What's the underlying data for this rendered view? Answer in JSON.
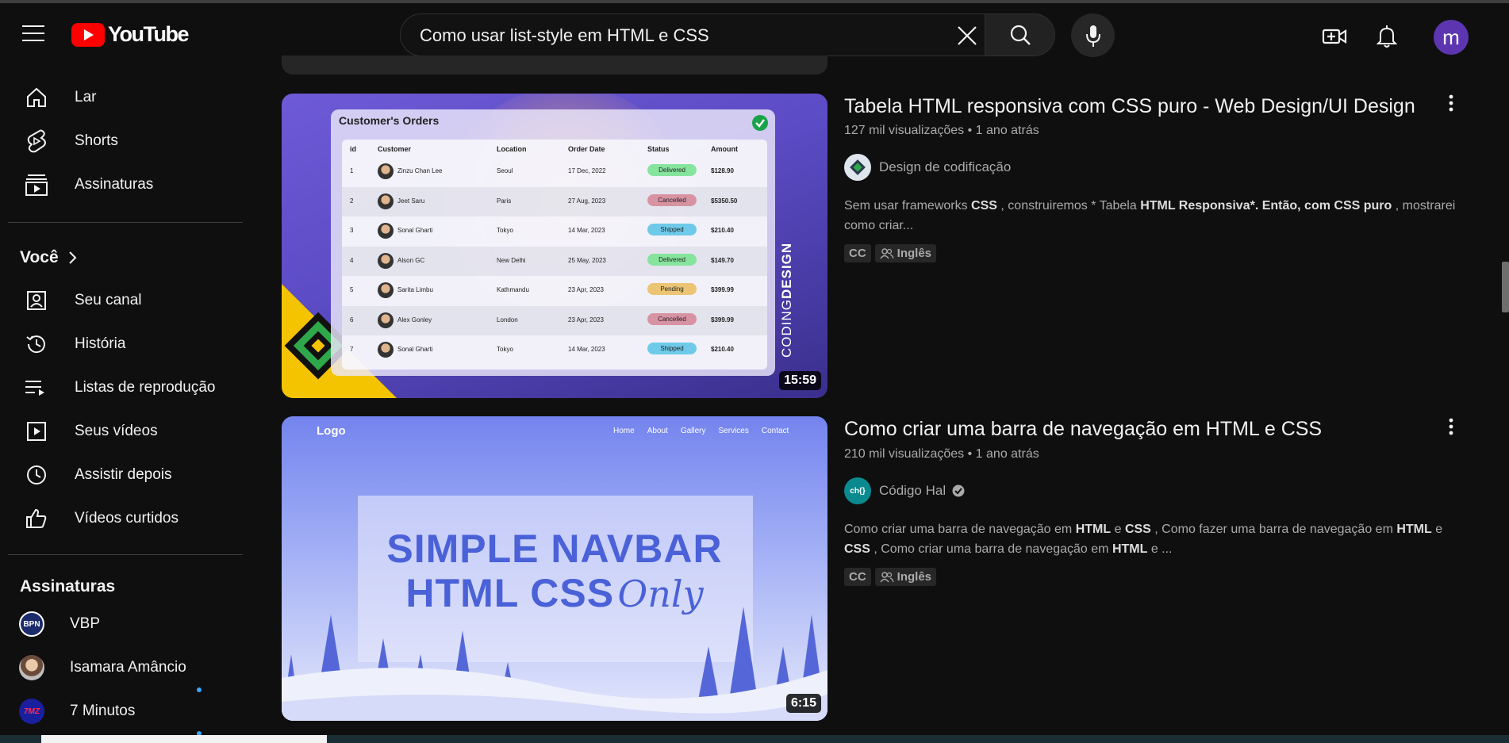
{
  "header": {
    "logo_text": "YouTube",
    "search_value": "Como usar list-style em HTML e CSS",
    "avatar_letter": "m",
    "icons": [
      "menu-icon",
      "youtube-logo-icon",
      "close-icon",
      "search-icon",
      "mic-icon",
      "create-video-icon",
      "bell-icon"
    ]
  },
  "sidebar": {
    "main": [
      {
        "label": "Lar",
        "icon": "home-icon"
      },
      {
        "label": "Shorts",
        "icon": "shorts-icon"
      },
      {
        "label": "Assinaturas",
        "icon": "subscriptions-icon"
      }
    ],
    "you_title": "Você",
    "you": [
      {
        "label": "Seu canal",
        "icon": "channel-icon"
      },
      {
        "label": "História",
        "icon": "history-icon"
      },
      {
        "label": "Listas de reprodução",
        "icon": "playlist-icon"
      },
      {
        "label": "Seus vídeos",
        "icon": "your-videos-icon"
      },
      {
        "label": "Assistir depois",
        "icon": "watch-later-icon"
      },
      {
        "label": "Vídeos curtidos",
        "icon": "like-icon"
      }
    ],
    "subs_title": "Assinaturas",
    "subs": [
      {
        "label": "VBP",
        "avatar": "BPN",
        "new": true
      },
      {
        "label": "Isamara Amâncio",
        "new": true
      },
      {
        "label": "7 Minutos",
        "avatar": "7MZ",
        "new": false
      }
    ]
  },
  "results": [
    {
      "title": "Tabela HTML responsiva com CSS puro - Web Design/UI Design",
      "meta": "127 mil visualizações • 1 ano atrás",
      "channel": "Design de codificação",
      "verified": false,
      "desc_parts": [
        {
          "t": "Sem usar frameworks ",
          "b": false
        },
        {
          "t": "CSS",
          "b": true
        },
        {
          "t": " , construiremos * Tabela ",
          "b": false
        },
        {
          "t": "HTML Responsiva*. Então, com CSS puro",
          "b": true
        },
        {
          "t": " , mostrarei como criar...",
          "b": false
        }
      ],
      "badges": [
        "CC",
        "Inglês"
      ],
      "duration": "15:59",
      "thumbnail": {
        "card_title": "Customer's Orders",
        "brand_text_a": "CODING",
        "brand_text_b": "DESIGN",
        "columns": [
          "id",
          "Customer",
          "Location",
          "Order Date",
          "Status",
          "Amount"
        ],
        "rows": [
          [
            "1",
            "Zinzu Chan Lee",
            "Seoul",
            "17 Dec, 2022",
            "Delivered",
            "$128.90"
          ],
          [
            "2",
            "Jeet Saru",
            "Paris",
            "27 Aug, 2023",
            "Cancelled",
            "$5350.50"
          ],
          [
            "3",
            "Sonal Gharti",
            "Tokyo",
            "14 Mar, 2023",
            "Shipped",
            "$210.40"
          ],
          [
            "4",
            "Alson GC",
            "New Delhi",
            "25 May, 2023",
            "Delivered",
            "$149.70"
          ],
          [
            "5",
            "Sarita Limbu",
            "Kathmandu",
            "23 Apr, 2023",
            "Pending",
            "$399.99"
          ],
          [
            "6",
            "Alex Gonley",
            "London",
            "23 Apr, 2023",
            "Cancelled",
            "$399.99"
          ],
          [
            "7",
            "Sonal Gharti",
            "Tokyo",
            "14 Mar, 2023",
            "Shipped",
            "$210.40"
          ]
        ],
        "status_colors": {
          "Delivered": "#86e49d",
          "Cancelled": "#d893a3",
          "Shipped": "#6fcaea",
          "Pending": "#ebc474"
        }
      }
    },
    {
      "title": "Como criar uma barra de navegação em HTML e CSS",
      "meta": "210 mil visualizações • 1 ano atrás",
      "channel": "Código Hal",
      "verified": true,
      "desc_parts": [
        {
          "t": "Como criar uma barra de navegação em ",
          "b": false
        },
        {
          "t": "HTML",
          "b": true
        },
        {
          "t": " e ",
          "b": false
        },
        {
          "t": "CSS",
          "b": true
        },
        {
          "t": " , Como fazer uma barra de navegação em ",
          "b": false
        },
        {
          "t": "HTML",
          "b": true
        },
        {
          "t": " e ",
          "b": false
        },
        {
          "t": "CSS",
          "b": true
        },
        {
          "t": " , Como criar uma barra de navegação em ",
          "b": false
        },
        {
          "t": "HTML",
          "b": true
        },
        {
          "t": " e ...",
          "b": false
        }
      ],
      "badges": [
        "CC",
        "Inglês"
      ],
      "duration": "6:15",
      "thumbnail": {
        "logo": "Logo",
        "nav": [
          "Home",
          "About",
          "Gallery",
          "Services",
          "Contact"
        ],
        "line1": "SIMPLE NAVBAR",
        "line2": "HTML CSS",
        "line2_script": "Only"
      }
    }
  ],
  "colors": {
    "background": "#0f0f0f",
    "youtube_red": "#ff0000",
    "avatar_purple": "#5e35b1",
    "new_dot": "#3ea6ff"
  }
}
